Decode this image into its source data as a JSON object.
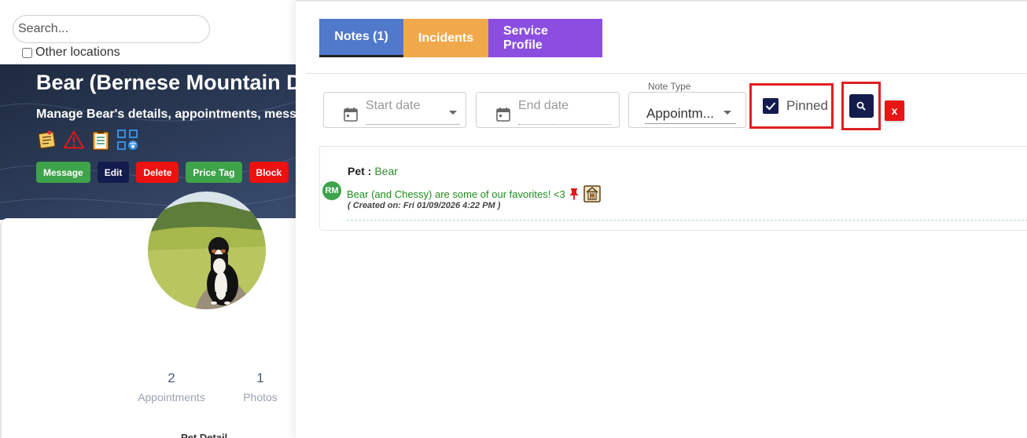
{
  "left_panel": {
    "search": {
      "placeholder": "Search..."
    },
    "other_locations_label": "Other locations",
    "header": {
      "title": "Bear (Bernese Mountain Do",
      "subtitle": "Manage Bear's details, appointments, messa",
      "icons": [
        "sticky-note-icon",
        "warning-icon",
        "clipboard-icon",
        "qr-paw-icon"
      ],
      "buttons": [
        {
          "label": "Message",
          "color": "#3ea34a"
        },
        {
          "label": "Edit",
          "color": "#141b4d"
        },
        {
          "label": "Delete",
          "color": "#ee1111"
        },
        {
          "label": "Price Tag",
          "color": "#3ea34a"
        },
        {
          "label": "Block",
          "color": "#ee1111"
        }
      ]
    },
    "stats": [
      {
        "value": "2",
        "label": "Appointments"
      },
      {
        "value": "1",
        "label": "Photos"
      }
    ],
    "section_peek": "Pet Detail"
  },
  "drawer": {
    "tabs": [
      {
        "label": "Notes (1)",
        "color": "#5079cc",
        "active": true
      },
      {
        "label": "Incidents",
        "color": "#f0a94a",
        "active": false
      },
      {
        "label": "Service Profile",
        "color": "#8b4ee0",
        "active": false
      }
    ],
    "filters": {
      "start_date_placeholder": "Start date",
      "end_date_placeholder": "End date",
      "note_type_label": "Note Type",
      "note_type_value": "Appointm...",
      "pinned_label": "Pinned",
      "pinned_checked": true,
      "clear_label": "x"
    },
    "notes": [
      {
        "avatar_initials": "RM",
        "pet_label": "Pet :",
        "pet_name": "Bear",
        "text": "Bear (and Chessy) are some of our favorites! <3",
        "pinned": true,
        "created": "( Created on: Fri 01/09/2026 4:22 PM )"
      }
    ]
  }
}
